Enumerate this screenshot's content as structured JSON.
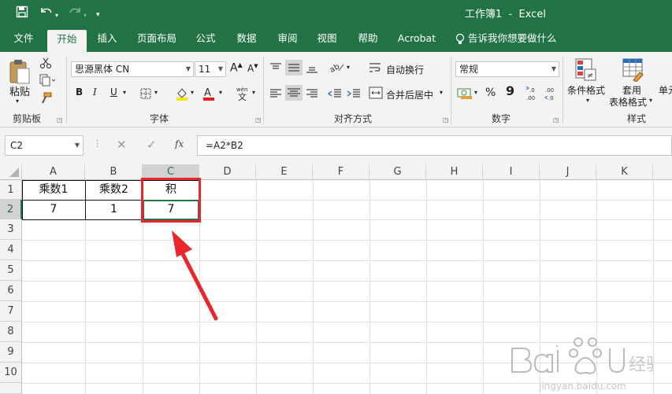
{
  "window": {
    "title": "工作簿1  -  Excel",
    "quick_access": [
      "save",
      "undo",
      "redo",
      "customize"
    ]
  },
  "tabs": [
    {
      "label": "文件"
    },
    {
      "label": "开始",
      "active": true
    },
    {
      "label": "插入"
    },
    {
      "label": "页面布局"
    },
    {
      "label": "公式"
    },
    {
      "label": "数据"
    },
    {
      "label": "审阅"
    },
    {
      "label": "视图"
    },
    {
      "label": "帮助"
    },
    {
      "label": "Acrobat"
    }
  ],
  "tell_me": "告诉我你想要做什么",
  "ribbon": {
    "clipboard": {
      "paste_label": "粘贴",
      "group_label": "剪贴板"
    },
    "font": {
      "font_name": "思源黑体 CN",
      "font_size": "11",
      "bold": "B",
      "italic": "I",
      "underline": "U",
      "grow": "A",
      "shrink": "A",
      "group_label": "字体"
    },
    "alignment": {
      "wrap_text": "自动换行",
      "merge_center": "合并后居中",
      "group_label": "对齐方式"
    },
    "number": {
      "format": "常规",
      "percent": "%",
      "comma": "9",
      "group_label": "数字"
    },
    "styles": {
      "conditional_format": "条件格式",
      "table_format_1": "套用",
      "table_format_2": "表格格式",
      "cell_styles": "单元",
      "group_label": "样式"
    }
  },
  "formula_bar": {
    "name_box": "C2",
    "fx": "fx",
    "formula": "=A2*B2"
  },
  "sheet": {
    "columns": [
      "A",
      "B",
      "C",
      "D",
      "E",
      "F",
      "G",
      "H",
      "I",
      "J",
      "K"
    ],
    "selected_column": "C",
    "rows": [
      "1",
      "2",
      "3",
      "4",
      "5",
      "6",
      "7",
      "8",
      "9",
      "10"
    ],
    "selected_row": "2",
    "cells": {
      "A1": "乘数1",
      "B1": "乘数2",
      "C1": "积",
      "A2": "7",
      "B2": "1",
      "C2": "7"
    }
  },
  "colors": {
    "excel_green": "#217346",
    "highlight_red": "#e8262b"
  }
}
